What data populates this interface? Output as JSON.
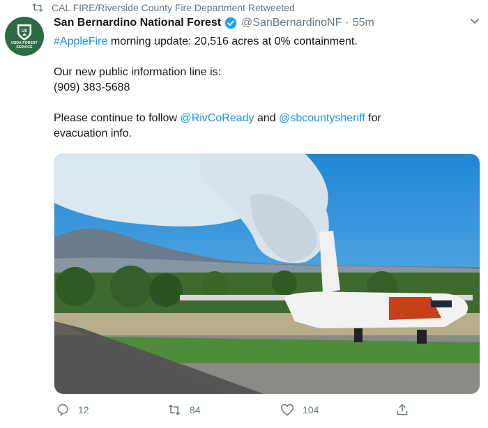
{
  "retweet": {
    "text": "CAL FIRE/Riverside County Fire Department Retweeted"
  },
  "avatar": {
    "lines": [
      "USDA FOREST",
      "SERVICE"
    ]
  },
  "tweet": {
    "name": "San Bernardino National Forest",
    "handle": "@SanBernardinoNF",
    "separator": "·",
    "time": "55m",
    "line1_hashtag": "#AppleFire",
    "line1_rest": " morning update: 20,516 acres at 0% containment.",
    "line2": "Our new public information line is:",
    "line3": "(909) 383-5688",
    "line4_a": "Please continue to follow ",
    "line4_mention1": "@RivCoReady",
    "line4_b": " and ",
    "line4_mention2": "@sbcountysheriff",
    "line4_c": " for",
    "line5": "evacuation info."
  },
  "actions": {
    "replies": "12",
    "retweets": "84",
    "likes": "104"
  },
  "colors": {
    "link": "#1b95e0",
    "muted": "#657786",
    "verified": "#1da1f2",
    "avatar_bg": "#2e6b45"
  },
  "icons": [
    "retweet-icon",
    "verified-badge-icon",
    "chevron-down-icon",
    "reply-icon",
    "retweet-action-icon",
    "like-icon",
    "share-icon"
  ]
}
